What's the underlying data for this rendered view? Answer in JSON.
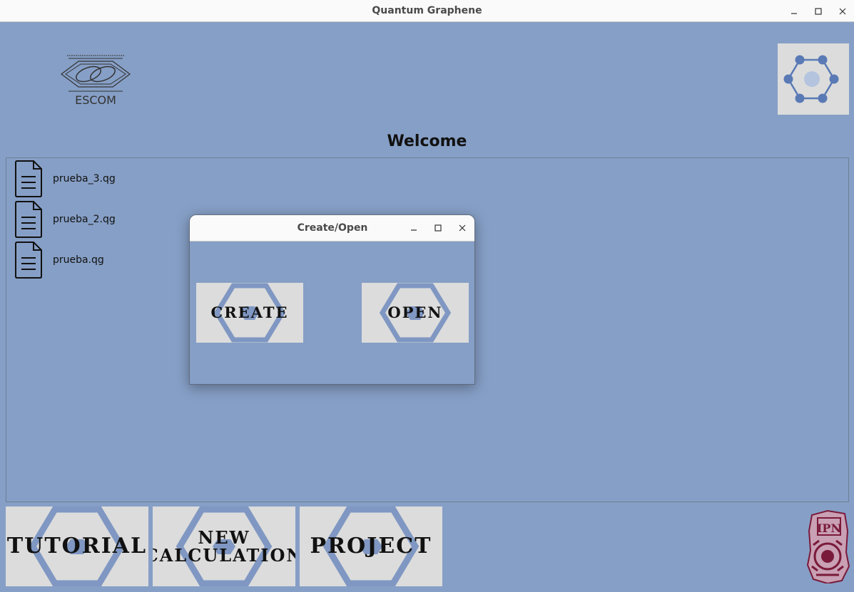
{
  "window": {
    "title": "Quantum Graphene",
    "controls": [
      "–",
      "□",
      "×"
    ]
  },
  "header": {
    "escom_logo_text": "ESCOM",
    "welcome": "Welcome"
  },
  "files": [
    {
      "name": "prueba_3.qg"
    },
    {
      "name": "prueba_2.qg"
    },
    {
      "name": "prueba.qg"
    }
  ],
  "dialog": {
    "title": "Create/Open",
    "controls": [
      "–",
      "□",
      "×"
    ],
    "create_label": "CREATE",
    "open_label": "OPEN"
  },
  "bottom_buttons": {
    "tutorial": "TUTORIAL",
    "new_calculation": "NEW\nCALCULATION",
    "project": "PROJECT"
  },
  "ipn_logo_text": "IPN",
  "colors": {
    "background": "#869fc6",
    "button_bg": "#dcdcdc",
    "hex_stroke": "#7f97c2",
    "graphene_node": "#5a7ab5",
    "ipn_maroon": "#7a1a3a"
  }
}
